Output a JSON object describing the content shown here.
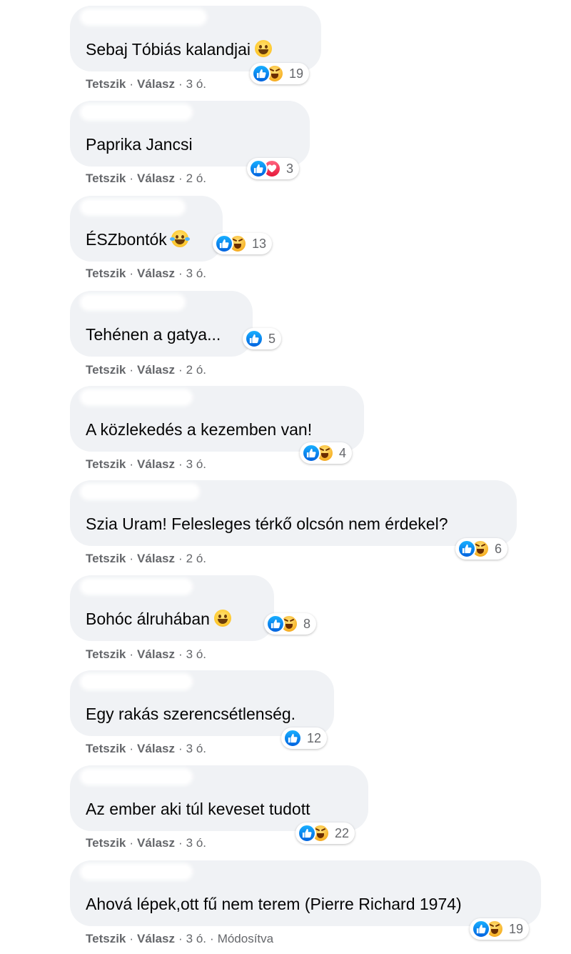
{
  "actions": {
    "like": "Tetszik",
    "reply": "Válasz",
    "edited": "Módosítva"
  },
  "comments": [
    {
      "text": "Sebaj Tóbiás kalandjai",
      "emoji": "grinning-face-icon",
      "time": "3 ó.",
      "reactions": [
        "like",
        "haha"
      ],
      "count": "19"
    },
    {
      "text": "Paprika Jancsi",
      "emoji": null,
      "time": "2 ó.",
      "reactions": [
        "like",
        "love"
      ],
      "count": "3"
    },
    {
      "text": "ÉSZbontók",
      "emoji": "tears-of-joy-icon",
      "time": "3 ó.",
      "reactions": [
        "like",
        "haha"
      ],
      "count": "13"
    },
    {
      "text": "Tehénen a gatya...",
      "emoji": null,
      "time": "2 ó.",
      "reactions": [
        "like"
      ],
      "count": "5"
    },
    {
      "text": "A közlekedés a kezemben van!",
      "emoji": null,
      "time": "3 ó.",
      "reactions": [
        "like",
        "haha"
      ],
      "count": "4"
    },
    {
      "text": "Szia Uram! Felesleges térkő olcsón nem érdekel?",
      "emoji": null,
      "time": "2 ó.",
      "reactions": [
        "like",
        "haha"
      ],
      "count": "6"
    },
    {
      "text": "Bohóc álruhában",
      "emoji": "tongue-face-icon",
      "time": "3 ó.",
      "reactions": [
        "like",
        "haha"
      ],
      "count": "8"
    },
    {
      "text": "Egy rakás szerencsétlenség.",
      "emoji": null,
      "time": "3 ó.",
      "reactions": [
        "like"
      ],
      "count": "12"
    },
    {
      "text": "Az ember aki túl keveset tudott",
      "emoji": null,
      "time": "3 ó.",
      "reactions": [
        "like",
        "haha"
      ],
      "count": "22"
    },
    {
      "text": "Ahová lépek,ott fű nem terem (Pierre Richard 1974)",
      "emoji": null,
      "time": "3 ó.",
      "reactions": [
        "like",
        "haha"
      ],
      "count": "19",
      "edited": true
    }
  ]
}
